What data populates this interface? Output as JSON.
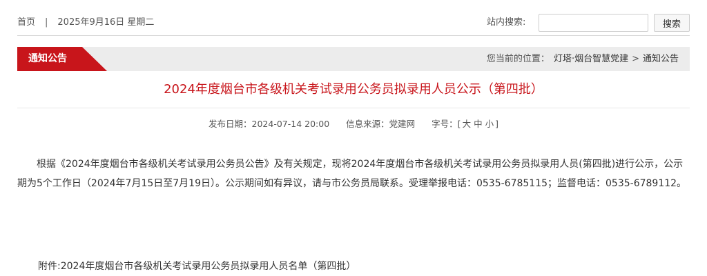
{
  "topbar": {
    "home_label": "首页",
    "separator": "|",
    "date": "2025年9月16日 星期二",
    "search_label": "站内搜索:",
    "search_value": "",
    "search_button": "搜索"
  },
  "section": {
    "tag": "通知公告",
    "breadcrumb_prefix": "您当前的位置：",
    "breadcrumb": [
      "灯塔·烟台智慧党建",
      "通知公告"
    ],
    "breadcrumb_sep": ">"
  },
  "article": {
    "title": "2024年度烟台市各级机关考试录用公务员拟录用人员公示（第四批）",
    "meta": {
      "publish_label": "发布日期：",
      "publish_date": "2024-07-14 20:00",
      "source_label": "信息来源：",
      "source": "党建网",
      "font_label": "字号：",
      "bracket_open": "[",
      "size_large": "大",
      "size_medium": "中",
      "size_small": "小",
      "bracket_close": "]"
    },
    "body": "根据《2024年度烟台市各级机关考试录用公务员公告》及有关规定，现将2024年度烟台市各级机关考试录用公务员拟录用人员(第四批)进行公示，公示期为5个工作日（2024年7月15日至7月19日）。公示期间如有异议，请与市公务员局联系。受理举报电话：0535-6785115；监督电话：0535-6789112。",
    "attachment": "附件:2024年度烟台市各级机关考试录用公务员拟录用人员名单（第四批）"
  },
  "colors": {
    "accent_red": "#c8151b",
    "bar_gray": "#ececec"
  }
}
